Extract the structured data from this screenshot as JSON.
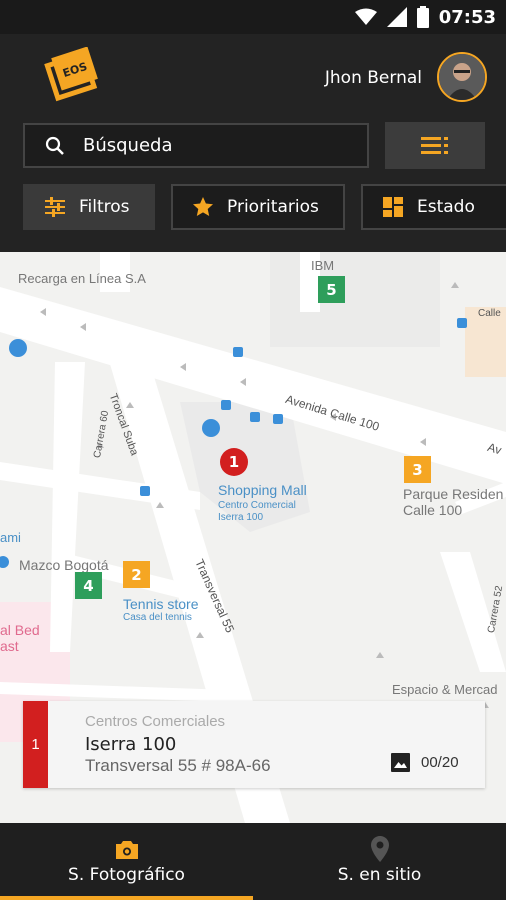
{
  "status_bar": {
    "time": "07:53",
    "icons": [
      "wifi-icon",
      "signal-icon",
      "battery-icon"
    ]
  },
  "header": {
    "logo_text": "EOS",
    "user_name": "Jhon Bernal",
    "search_label": "Búsqueda",
    "filters": [
      {
        "label": "Filtros",
        "icon": "sliders-icon",
        "active": true
      },
      {
        "label": "Prioritarios",
        "icon": "star-icon",
        "active": false
      },
      {
        "label": "Estado",
        "icon": "dashboard-icon",
        "active": false
      }
    ]
  },
  "map": {
    "labels": {
      "recarga": "Recarga en Línea S.A",
      "ibm": "IBM",
      "avenida": "Avenida Calle 100",
      "troncal": "Troncal Suba",
      "carrera60": "Carrera 60",
      "transversal": "Transversal 55",
      "carrera52": "Carrera 52",
      "calle": "Calle",
      "shopping": "Shopping Mall",
      "centro": "Centro Comercial",
      "iserra": "Iserra 100",
      "parque": "Parque Residen",
      "calle100": "Calle 100",
      "ami": "ami",
      "mazco": "Mazco Bogotá",
      "tennis": "Tennis store",
      "casa": "Casa del tennis",
      "bed": "al Bed",
      "ast": "ast",
      "espacio": "Espacio & Mercad",
      "av_edge": "Av"
    },
    "markers": [
      {
        "num": "1",
        "color": "red"
      },
      {
        "num": "2",
        "color": "orange"
      },
      {
        "num": "3",
        "color": "orange"
      },
      {
        "num": "4",
        "color": "green"
      },
      {
        "num": "5",
        "color": "green"
      }
    ]
  },
  "card": {
    "number": "1",
    "category": "Centros Comerciales",
    "title": "Iserra 100",
    "address": "Transversal 55 # 98A-66",
    "photo_count": "00/20"
  },
  "bottom_nav": [
    {
      "label": "S. Fotográfico",
      "icon": "camera-icon",
      "active": true
    },
    {
      "label": "S. en sitio",
      "icon": "location-pin-icon",
      "active": false
    }
  ],
  "colors": {
    "accent": "#f5a623",
    "red": "#d21f1f",
    "green": "#2e9e5b",
    "dark": "#232323"
  }
}
